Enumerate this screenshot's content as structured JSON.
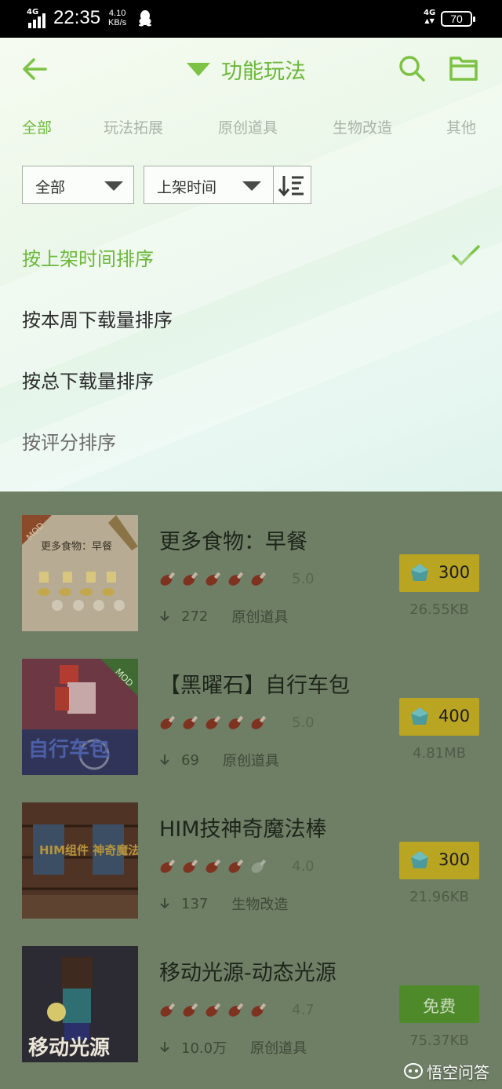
{
  "status_bar": {
    "network_left": "4G",
    "time": "22:35",
    "speed_value": "4.10",
    "speed_unit": "KB/s",
    "network_right": "4G",
    "battery": "70"
  },
  "header": {
    "title": "功能玩法",
    "icons": [
      "back-arrow-icon",
      "dropdown-triangle-icon",
      "search-icon",
      "folder-icon"
    ],
    "accent_color": "#6cb83a"
  },
  "tabs": [
    {
      "label": "全部",
      "active": true
    },
    {
      "label": "玩法拓展",
      "active": false
    },
    {
      "label": "原创道具",
      "active": false
    },
    {
      "label": "生物改造",
      "active": false
    },
    {
      "label": "其他",
      "active": false
    }
  ],
  "filters": {
    "category_value": "全部",
    "sort_value": "上架时间"
  },
  "sort_options": [
    {
      "label": "按上架时间排序",
      "selected": true
    },
    {
      "label": "按本周下载量排序",
      "selected": false
    },
    {
      "label": "按总下载量排序",
      "selected": false
    },
    {
      "label": "按评分排序",
      "selected": false
    }
  ],
  "items": [
    {
      "title": "更多食物：早餐",
      "score": "5.0",
      "rating": 5,
      "downloads": "272",
      "category": "原创道具",
      "price": "300",
      "free": false,
      "size": "26.55KB",
      "thumb_text": "更多食物：早餐",
      "badge": "MOD"
    },
    {
      "title": "【黑曜石】自行车包",
      "score": "5.0",
      "rating": 5,
      "downloads": "69",
      "category": "原创道具",
      "price": "400",
      "free": false,
      "size": "4.81MB",
      "thumb_text": "自行车包",
      "badge": "MOD"
    },
    {
      "title": "HIM技神奇魔法棒",
      "score": "4.0",
      "rating": 4,
      "downloads": "137",
      "category": "生物改造",
      "price": "300",
      "free": false,
      "size": "21.96KB",
      "thumb_text": "HIM组件 神奇魔法棒",
      "badge": ""
    },
    {
      "title": "移动光源-动态光源",
      "score": "4.7",
      "rating": 5,
      "downloads": "10.0万",
      "category": "原创道具",
      "price": "免费",
      "free": true,
      "size": "75.37KB",
      "thumb_text": "移动光源",
      "badge": ""
    }
  ],
  "watermark": "悟空问答"
}
